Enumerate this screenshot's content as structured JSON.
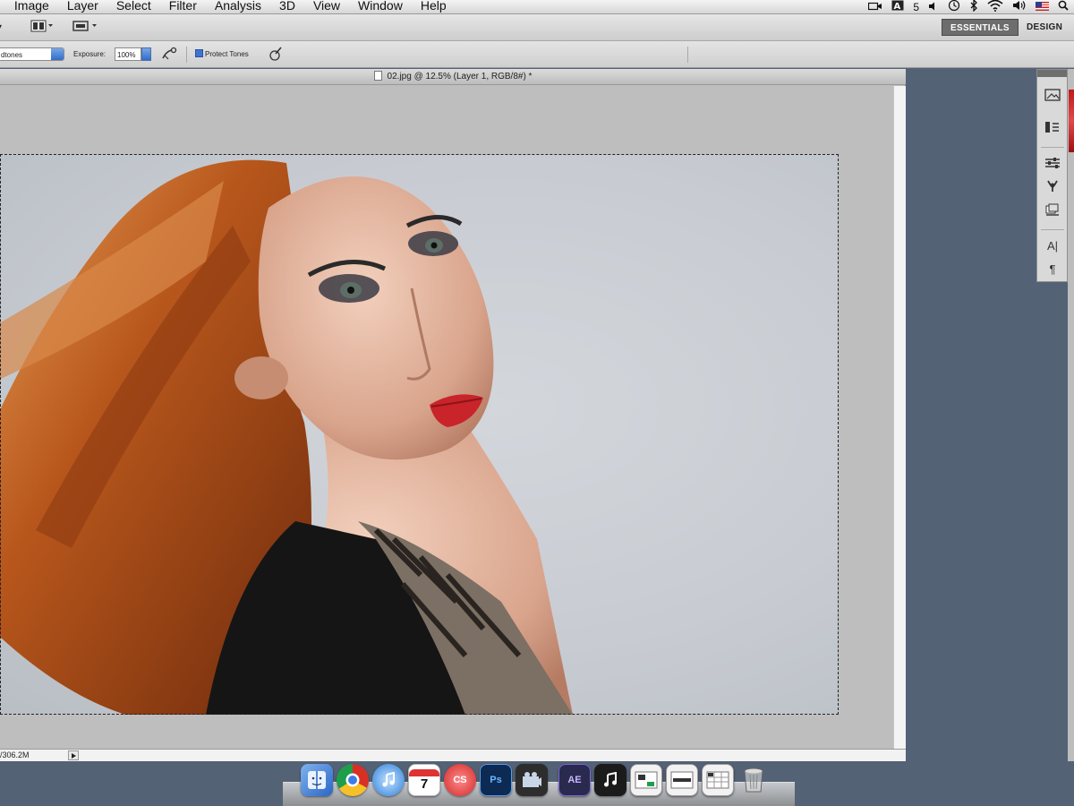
{
  "menubar": {
    "items": [
      "t",
      "Image",
      "Layer",
      "Select",
      "Filter",
      "Analysis",
      "3D",
      "View",
      "Window",
      "Help"
    ],
    "status_badge": "5"
  },
  "appbar": {
    "workspaces": [
      "ESSENTIALS",
      "DESIGN"
    ]
  },
  "options": {
    "range_value": "dtones",
    "exposure_label": "Exposure:",
    "exposure_value": "100%",
    "protect_tones_label": "Protect Tones"
  },
  "document": {
    "title": "02.jpg @ 12.5% (Layer 1, RGB/8#) *",
    "status_text": "/306.2M"
  },
  "panels": {
    "char_icon_text": "A|",
    "para_icon_text": "¶"
  },
  "dock": {
    "calendar_day": "7",
    "cs_label": "CS",
    "ps_label": "Ps",
    "ae_label": "AE"
  },
  "colors": {
    "desktop": "#546275",
    "accent_blue": "#3d74d1",
    "workspace_active": "#6d6d6d"
  }
}
